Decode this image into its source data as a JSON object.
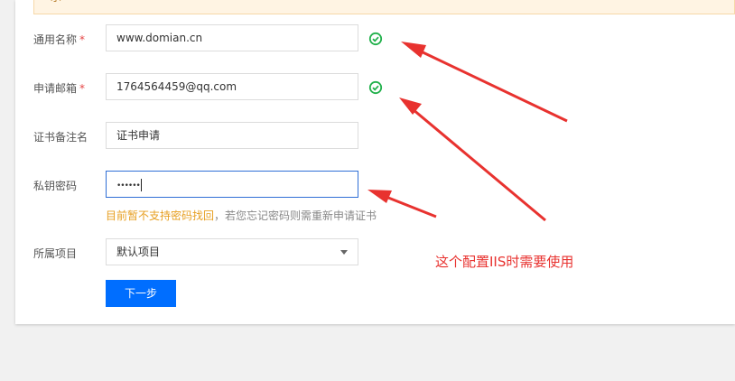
{
  "notice": {
    "text": "示"
  },
  "form": {
    "common_name": {
      "label": "通用名称",
      "required": "*",
      "value": "www.domian.cn"
    },
    "email": {
      "label": "申请邮箱",
      "required": "*",
      "value": "1764564459@qq.com"
    },
    "remark": {
      "label": "证书备注名",
      "value": "证书申请"
    },
    "private_key_password": {
      "label": "私钥密码",
      "value": "••••••",
      "hint_warning": "目前暂不支持密码找回",
      "hint_rest": "，若您忘记密码则需重新申请证书"
    },
    "project": {
      "label": "所属项目",
      "value": "默认项目"
    },
    "next_button": "下一步"
  },
  "annotation": {
    "text": "这个配置IIS时需要使用",
    "color": "#e8322f"
  },
  "icons": [
    "check-circle-icon",
    "check-circle-icon",
    "chevron-down-icon"
  ],
  "colors": {
    "primary": "#006eff",
    "success": "#22b14c",
    "warning": "#e79f21",
    "required": "#e54545"
  }
}
